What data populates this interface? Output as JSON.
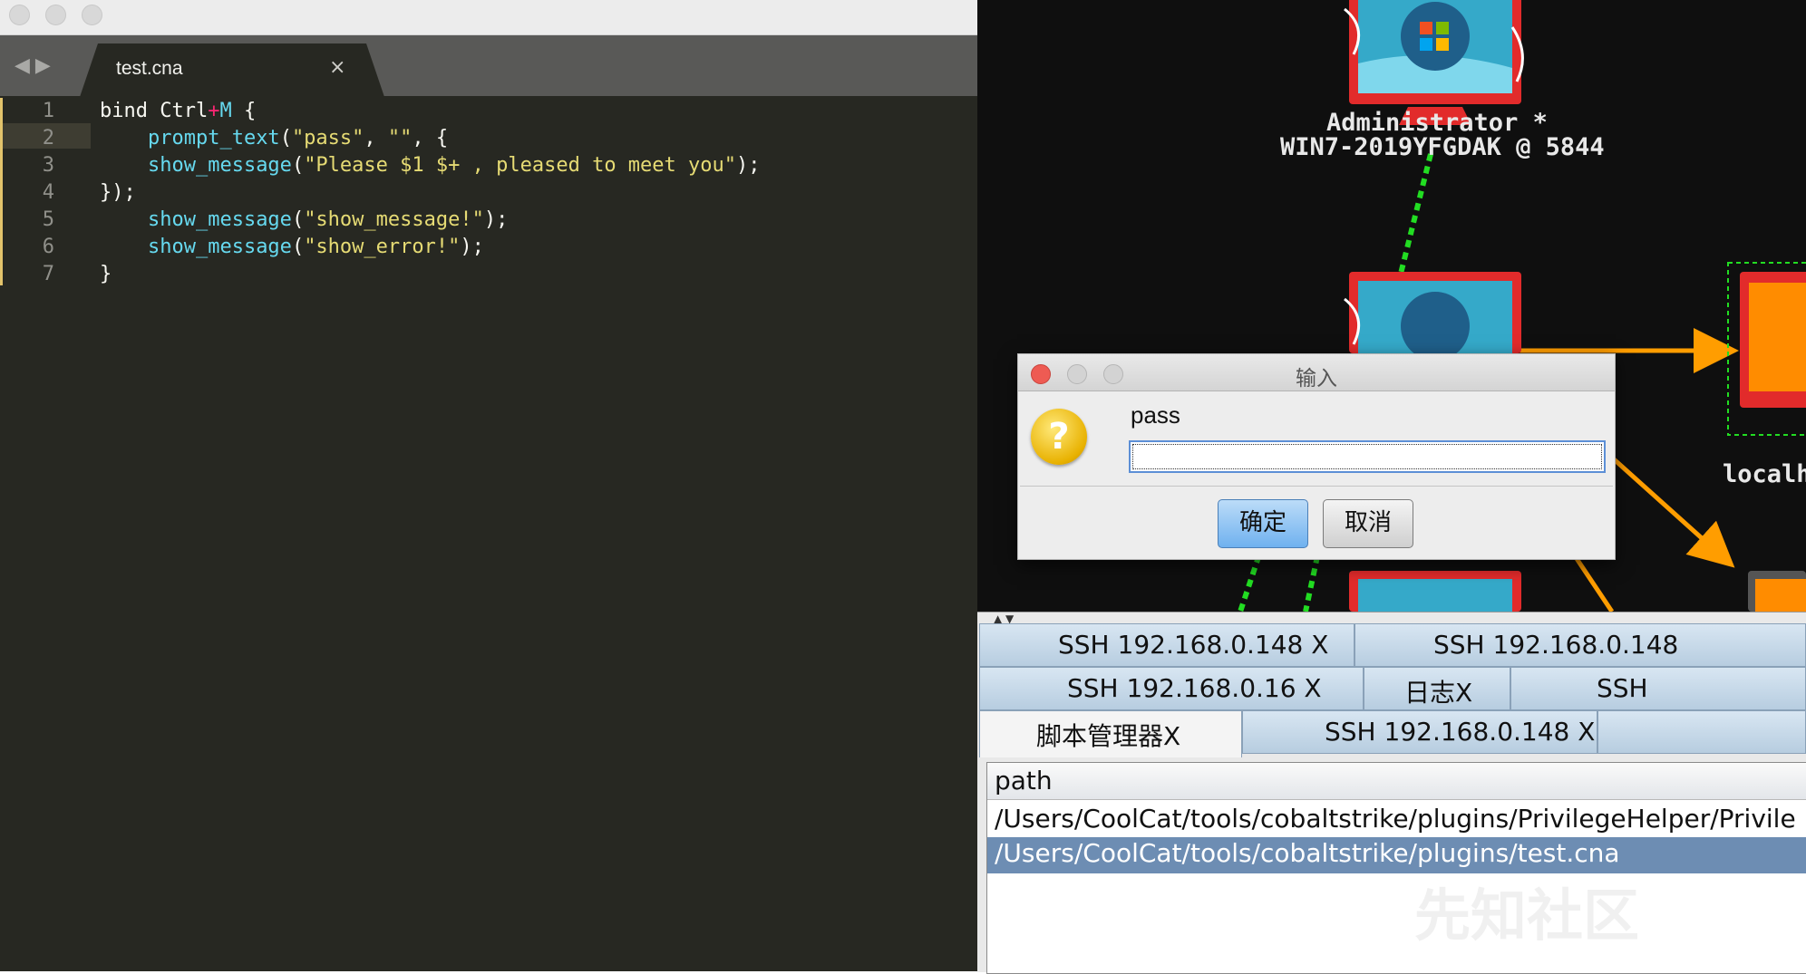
{
  "editor": {
    "tab": {
      "label": "test.cna",
      "close": "×"
    },
    "nav": {
      "back": "◀",
      "forward": "▶"
    },
    "line_numbers": [
      "1",
      "2",
      "3",
      "4",
      "5",
      "6",
      "7"
    ],
    "lines": [
      [
        {
          "t": "bind Ctrl",
          "c": "plain"
        },
        {
          "t": "+",
          "c": "op"
        },
        {
          "t": "M",
          "c": "fn"
        },
        {
          "t": " {",
          "c": "plain"
        }
      ],
      [
        {
          "t": "    ",
          "c": "plain"
        },
        {
          "t": "prompt_text",
          "c": "fn"
        },
        {
          "t": "(",
          "c": "plain"
        },
        {
          "t": "\"pass\"",
          "c": "str"
        },
        {
          "t": ", ",
          "c": "plain"
        },
        {
          "t": "\"\"",
          "c": "str"
        },
        {
          "t": ", {",
          "c": "plain"
        }
      ],
      [
        {
          "t": "    ",
          "c": "plain"
        },
        {
          "t": "show_message",
          "c": "fn"
        },
        {
          "t": "(",
          "c": "plain"
        },
        {
          "t": "\"Please $1 $+ , pleased to meet you\"",
          "c": "str"
        },
        {
          "t": ");",
          "c": "plain"
        }
      ],
      [
        {
          "t": "});",
          "c": "plain"
        }
      ],
      [
        {
          "t": "    ",
          "c": "plain"
        },
        {
          "t": "show_message",
          "c": "fn"
        },
        {
          "t": "(",
          "c": "plain"
        },
        {
          "t": "\"show_message!\"",
          "c": "str"
        },
        {
          "t": ");",
          "c": "plain"
        }
      ],
      [
        {
          "t": "    ",
          "c": "plain"
        },
        {
          "t": "show_message",
          "c": "fn"
        },
        {
          "t": "(",
          "c": "plain"
        },
        {
          "t": "\"show_error!\"",
          "c": "str"
        },
        {
          "t": ");",
          "c": "plain"
        }
      ],
      [
        {
          "t": "}",
          "c": "plain"
        }
      ]
    ]
  },
  "graph": {
    "node_top": {
      "line1": "Administrator *",
      "line2": "WIN7-2019YFGDAK @ 5844"
    },
    "node_right_label": "localh",
    "partial_digit": "4",
    "colors": {
      "session": "#ff9d00",
      "pivot": "#22dd22",
      "monitor": "#e22b2b"
    }
  },
  "dialog": {
    "title": "输入",
    "prompt": "pass",
    "input_value": "",
    "ok_label": "确定",
    "cancel_label": "取消",
    "icon": "question-icon"
  },
  "bottom": {
    "tabs_row1": [
      "SSH 192.168.0.148   X",
      "SSH 192.168.0.148"
    ],
    "tabs_row2": [
      "SSH 192.168.0.16   X",
      "日志X",
      "SSH"
    ],
    "tabs_row3": [
      "脚本管理器X",
      "SSH 192.168.0.148   X"
    ],
    "table": {
      "header": "path",
      "rows": [
        "/Users/CoolCat/tools/cobaltstrike/plugins/PrivilegeHelper/Privile",
        "/Users/CoolCat/tools/cobaltstrike/plugins/test.cna"
      ],
      "selected_index": 1
    },
    "watermark": "先知社区"
  }
}
